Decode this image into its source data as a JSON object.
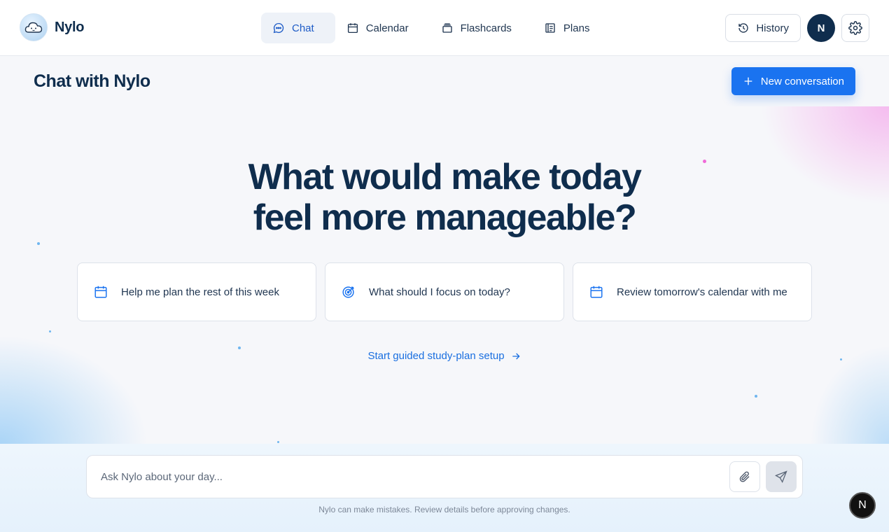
{
  "brand": {
    "name": "Nylo"
  },
  "nav": {
    "items": [
      {
        "label": "Chat",
        "icon": "chat-bubble-icon",
        "active": true
      },
      {
        "label": "Calendar",
        "icon": "calendar-icon",
        "active": false
      },
      {
        "label": "Flashcards",
        "icon": "flashcards-icon",
        "active": false
      },
      {
        "label": "Plans",
        "icon": "plans-icon",
        "active": false
      }
    ]
  },
  "actions": {
    "history_label": "History",
    "avatar_initial": "N"
  },
  "header": {
    "title": "Chat with Nylo",
    "new_conversation_label": "New conversation"
  },
  "hero": {
    "headline_line1": "What would make today",
    "headline_line2": "feel more manageable?",
    "suggestions": [
      {
        "label": "Help me plan the rest of this week",
        "icon": "calendar-icon"
      },
      {
        "label": "What should I focus on today?",
        "icon": "target-icon"
      },
      {
        "label": "Review tomorrow's calendar with me",
        "icon": "calendar-icon"
      }
    ],
    "guided_link": "Start guided study-plan setup"
  },
  "composer": {
    "placeholder": "Ask Nylo about your day...",
    "disclaimer": "Nylo can make mistakes. Review details before approving changes."
  },
  "fab": {
    "label": "N"
  },
  "colors": {
    "primary": "#1a73f0",
    "navy": "#0f2d4d",
    "active_nav": "#1e5cc7"
  }
}
